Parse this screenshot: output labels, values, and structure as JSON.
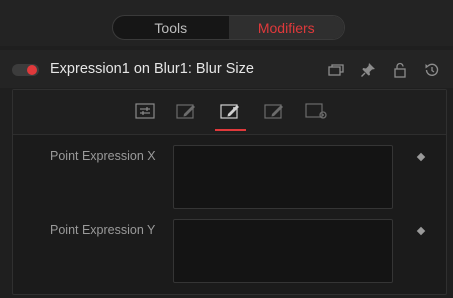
{
  "tabs": [
    {
      "label": "Tools",
      "active": false
    },
    {
      "label": "Modifiers",
      "active": true
    }
  ],
  "header": {
    "title": "Expression1 on Blur1: Blur Size",
    "enabled": true,
    "icons": [
      "window-icon",
      "pin-icon",
      "lock-icon",
      "reset-icon"
    ]
  },
  "icon_tabs": {
    "items": [
      "sliders-icon",
      "expression-edit-icon",
      "expression-edit-active-icon",
      "expression-edit-alt-icon",
      "settings-icon"
    ],
    "active_index": 2
  },
  "fields": [
    {
      "label": "Point Expression X",
      "value": ""
    },
    {
      "label": "Point Expression Y",
      "value": ""
    }
  ],
  "colors": {
    "accent": "#e0393b",
    "background": "#1f1f1f",
    "text": "#c8c8c8"
  }
}
